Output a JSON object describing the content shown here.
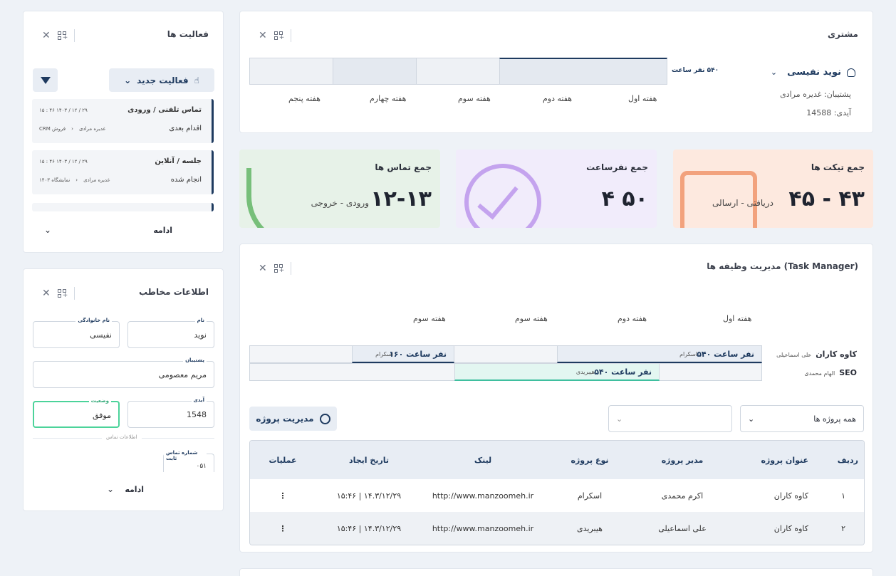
{
  "customer": {
    "title": "مشتری",
    "name": "نوید نفیسی",
    "support": "پشتیبان: غدیره مرادی",
    "id": "آیدی: 14588",
    "hours": "۵۴۰ نفر ساعت",
    "weeks": [
      "هفته اول",
      "هفته دوم",
      "هفته سوم",
      "هفته چهارم",
      "هفته پنجم"
    ]
  },
  "stats": [
    {
      "label": "جمع تیکت ها",
      "value": "۴۵ - ۴۳",
      "sub": "دریافتی - ارسالی",
      "color": "#fde9df"
    },
    {
      "label": "جمع نفرساعت",
      "value": "۴ ۵۰",
      "sub": "",
      "color": "#f1ecfb"
    },
    {
      "label": "جمع تماس ها",
      "value": "۱۲-۱۳",
      "sub": "ورودی - خروجی",
      "color": "#e7f2e8"
    }
  ],
  "tasks": {
    "title": "مدیریت وظیفه ها (Task Manager)",
    "weeks": [
      "هفته اول",
      "هفته دوم",
      "هفته سوم",
      "هفته سوم"
    ],
    "rows": [
      {
        "name": "کاوه کاران",
        "person": "علی اسماعیلی"
      },
      {
        "name": "SEO",
        "person": "الهام محمدی"
      }
    ],
    "bars": [
      {
        "hours": "۵۴۰ نفر ساعت",
        "tag": "اسکرام"
      },
      {
        "hours": "۱۶۰ نفر ساعت",
        "tag": "اسکرام"
      },
      {
        "hours": "۵۴۰ نفر ساعت",
        "tag": "هیبریدی"
      }
    ],
    "manage_label": "مدیریت پروژه",
    "filter_all": "همه پروژه ها",
    "columns": [
      "ردیف",
      "عنوان پروژه",
      "مدیر پروژه",
      "نوع پروژه",
      "لینک",
      "تاریخ ایجاد",
      "عملیات"
    ],
    "table": [
      [
        "۱",
        "کاوه کاران",
        "اکرم محمدی",
        "اسکرام",
        "http://www.manzoomeh.ir",
        "۱۴.۳/۱۲/۲۹ | ۱۵:۴۶"
      ],
      [
        "۲",
        "کاوه کاران",
        "علی اسماعیلی",
        "هیبریدی",
        "http://www.manzoomeh.ir",
        "۱۴.۳/۱۲/۲۹ | ۱۵:۴۶"
      ]
    ]
  },
  "activities": {
    "title": "فعالیت ها",
    "new_label": "فعالیت جدید",
    "items": [
      {
        "title": "تماس تلفنی / ورودی",
        "meta": "۱۵ : ۴۶  ۱۴۰۳ / ۱۲ / ۲۹",
        "status": "اقدام بعدی",
        "owner": "غدیره مرادی",
        "source": "فروش CRM"
      },
      {
        "title": "جلسه / آنلاین",
        "meta": "۱۵ : ۴۶  ۱۴۰۳ / ۱۲ / ۲۹",
        "status": "انجام شده",
        "owner": "غدیره مرادی",
        "source": "نمایشگاه ۱۴۰۳"
      }
    ],
    "more": "ادامه"
  },
  "contact": {
    "title": "اطلاعات مخاطب",
    "fields": [
      {
        "label": "نام",
        "value": "نوید"
      },
      {
        "label": "نام خانوادگی",
        "value": "نفیسی"
      },
      {
        "label": "پشتیبان",
        "value": "مریم معصومی"
      },
      {
        "label": "آیدی",
        "value": "1548"
      },
      {
        "label": "وضعیت",
        "value": "موفق"
      },
      {
        "label": "شماره تماس ثابت",
        "value": "۰۵۱"
      }
    ],
    "divider": "اطلاعات تماس",
    "more": "ادامه"
  }
}
